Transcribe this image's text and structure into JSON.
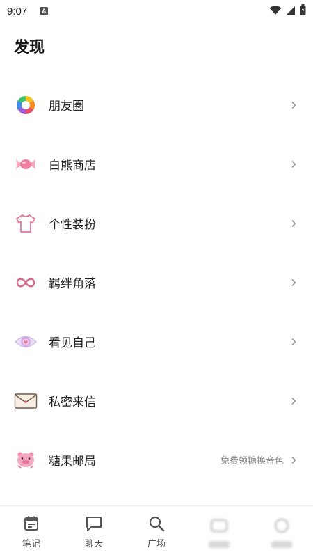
{
  "status_bar": {
    "time": "9:07",
    "app_icon_letter": "A"
  },
  "page": {
    "title": "发现"
  },
  "menu": {
    "items": [
      {
        "label": "朋友圈",
        "icon": "aperture-icon"
      },
      {
        "label": "白熊商店",
        "icon": "candy-icon"
      },
      {
        "label": "个性装扮",
        "icon": "tshirt-icon"
      },
      {
        "label": "羁绊角落",
        "icon": "infinity-icon"
      },
      {
        "label": "看见自己",
        "icon": "eye-icon"
      },
      {
        "label": "私密来信",
        "icon": "envelope-icon"
      },
      {
        "label": "糖果邮局",
        "icon": "pig-icon",
        "extra": "免费领糖换音色"
      }
    ]
  },
  "bottom_nav": {
    "items": [
      {
        "label": "笔记",
        "icon": "calendar-icon"
      },
      {
        "label": "聊天",
        "icon": "chat-bubble-icon"
      },
      {
        "label": "广场",
        "icon": "search-icon"
      }
    ]
  },
  "colors": {
    "accent_pink": "#e8739a",
    "text_primary": "#222222",
    "text_secondary": "#8a8a8a",
    "chevron": "#9a9a9a"
  }
}
